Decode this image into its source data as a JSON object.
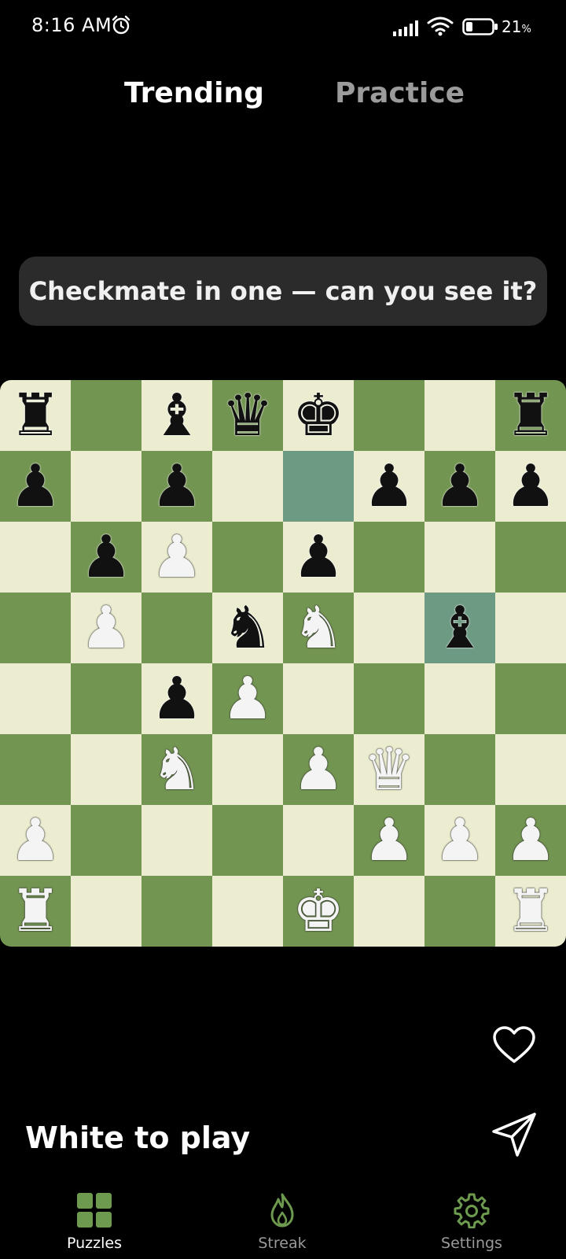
{
  "status_bar": {
    "time": "8:16 AM",
    "battery_percent": "21",
    "battery_unit": "%",
    "icons": [
      "alarm-icon",
      "signal-icon",
      "wifi-icon",
      "battery-icon"
    ]
  },
  "tabs": [
    {
      "label": "Trending",
      "active": true
    },
    {
      "label": "Practice",
      "active": false
    }
  ],
  "puzzle": {
    "prompt": "Checkmate in one — can you see it?",
    "turn": "White to play",
    "board": [
      [
        "br",
        "",
        "bb",
        "bq",
        "bk",
        "",
        "",
        "br"
      ],
      [
        "bp",
        "",
        "bp",
        "",
        "",
        "bp",
        "bp",
        "bp"
      ],
      [
        "",
        "bp",
        "wp",
        "",
        "bp",
        "",
        "",
        ""
      ],
      [
        "",
        "wp",
        "",
        "bn",
        "wn",
        "",
        "bb",
        ""
      ],
      [
        "",
        "",
        "bp",
        "wp",
        "",
        "",
        "",
        ""
      ],
      [
        "",
        "",
        "wn",
        "",
        "wp",
        "wq",
        "",
        ""
      ],
      [
        "wp",
        "",
        "",
        "",
        "",
        "wp",
        "wp",
        "wp"
      ],
      [
        "wr",
        "",
        "",
        "",
        "wk",
        "",
        "",
        "wr"
      ]
    ],
    "highlighted_squares": [
      "e7",
      "g5"
    ]
  },
  "actions": {
    "like_icon": "heart-icon",
    "share_icon": "send-icon"
  },
  "bottom_nav": [
    {
      "label": "Puzzles",
      "icon": "grid-icon",
      "active": true
    },
    {
      "label": "Streak",
      "icon": "flame-icon",
      "active": false
    },
    {
      "label": "Settings",
      "icon": "gear-icon",
      "active": false
    }
  ],
  "colors": {
    "board_light": "#ebecd0",
    "board_dark": "#739552",
    "highlight": "#6d9a83",
    "accent_green": "#6d9a4f",
    "background": "#000000"
  }
}
